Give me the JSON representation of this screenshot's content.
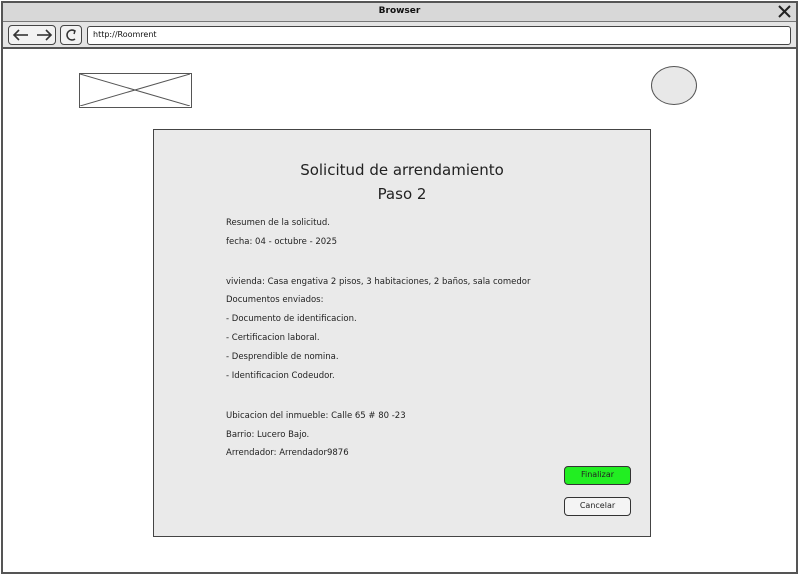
{
  "browser": {
    "title": "Browser",
    "url": "http://Roomrent"
  },
  "form": {
    "title": "Solicitud de arrendamiento",
    "step": "Paso 2",
    "summary_heading": "Resumen de la solicitud.",
    "date": "fecha: 04 - octubre - 2025",
    "housing": "vivienda: Casa engativa 2 pisos, 3 habitaciones, 2 baños, sala comedor",
    "documents_heading": "Documentos enviados:",
    "documents": [
      "- Documento de identificacion.",
      "- Certificacion laboral.",
      "- Desprendible de nomina.",
      "- Identificacion Codeudor."
    ],
    "location": "Ubicacion del inmueble:  Calle 65 # 80 -23",
    "neighborhood": "Barrio: Lucero Bajo.",
    "landlord": "Arrendador: Arrendador9876"
  },
  "buttons": {
    "finish": "Finalizar",
    "cancel": "Cancelar"
  },
  "colors": {
    "finish_button": "#22ee22",
    "panel_background": "#eaeaea"
  },
  "icons": [
    "close-icon",
    "back-arrow-icon",
    "forward-arrow-icon",
    "reload-icon",
    "image-placeholder-icon",
    "avatar"
  ]
}
